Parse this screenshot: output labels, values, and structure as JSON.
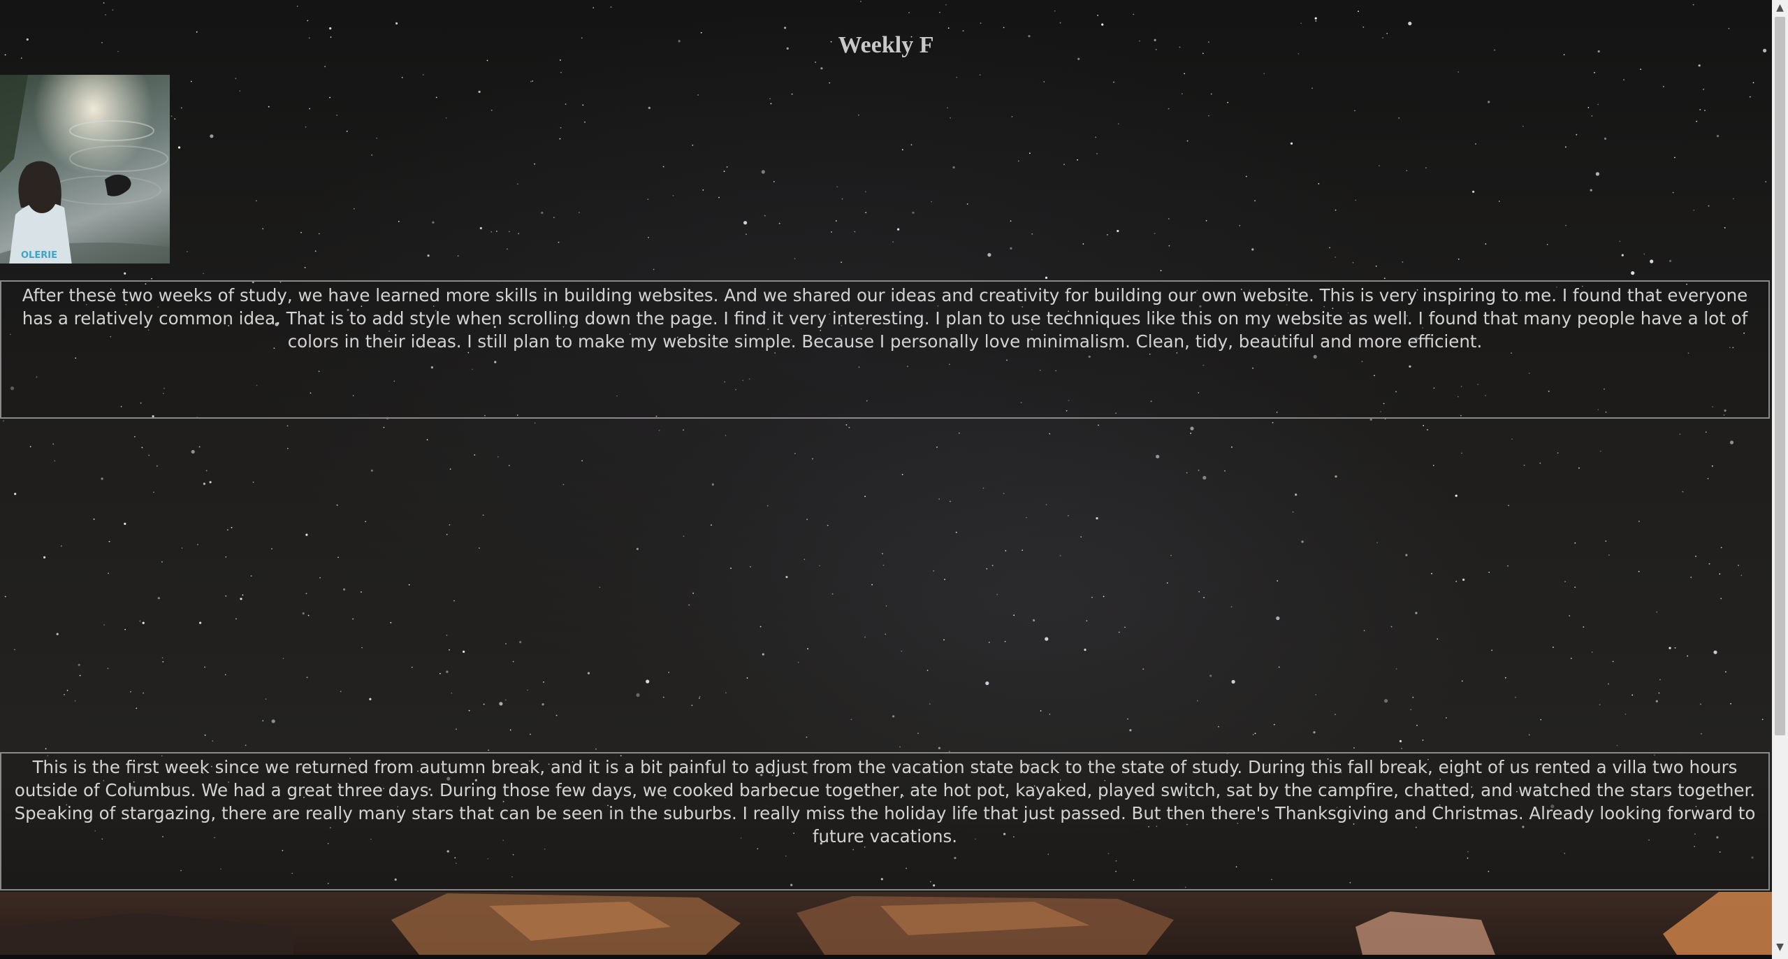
{
  "page": {
    "title": "Weekly F"
  },
  "photo": {
    "shirt_text": "OLERIE"
  },
  "paragraphs": [
    "After these two weeks of study, we have learned more skills in building websites. And we shared our ideas and creativity for building our own website. This is very inspiring to me. I found that everyone has a relatively common idea. That is to add style when scrolling down the page. I find it very interesting. I plan to use techniques like this on my website as well. I found that many people have a lot of colors in their ideas. I still plan to make my website simple. Because I personally love minimalism. Clean, tidy, beautiful and more efficient.",
    "This is the first week since we returned from autumn break, and it is a bit painful to adjust from the vacation state back to the state of study. During this fall break, eight of us rented a villa two hours outside of Columbus. We had a great three days. During those few days, we cooked barbecue together, ate hot pot, kayaked, played switch, sat by the campfire, chatted, and watched the stars together. Speaking of stargazing, there are really many stars that can be seen in the suburbs. I really miss the holiday life that just passed. But then there's Thanksgiving and Christmas. Already looking forward to future vacations."
  ],
  "scrollbar": {
    "up_icon": "arrow-up-icon",
    "down_icon": "arrow-down-icon"
  }
}
